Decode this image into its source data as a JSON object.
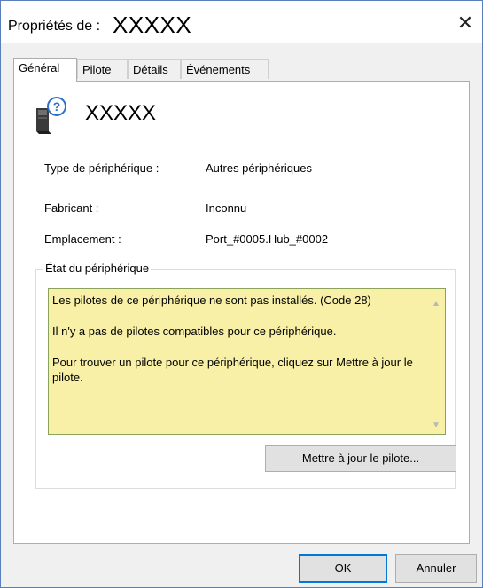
{
  "window": {
    "title_prefix": "Propriétés de :",
    "title_name": "XXXXX",
    "close_glyph": "✕"
  },
  "tabs": [
    {
      "label": "Général",
      "active": true
    },
    {
      "label": "Pilote",
      "active": false
    },
    {
      "label": "Détails",
      "active": false
    },
    {
      "label": "Événements",
      "active": false
    }
  ],
  "device": {
    "icon": "unknown-device-icon",
    "name": "XXXXX"
  },
  "properties": [
    {
      "label": "Type de périphérique :",
      "value": "Autres périphériques"
    },
    {
      "label": "Fabricant :",
      "value": "Inconnu"
    },
    {
      "label": "Emplacement :",
      "value": "Port_#0005.Hub_#0002"
    }
  ],
  "status_group": {
    "legend": "État du périphérique",
    "lines": [
      "Les pilotes de ce périphérique ne sont pas installés. (Code 28)",
      "Il n'y a pas de pilotes compatibles pour ce périphérique.",
      "Pour trouver un pilote pour ce périphérique, cliquez sur Mettre à jour le pilote."
    ],
    "update_button": "Mettre à jour le pilote..."
  },
  "footer": {
    "ok": "OK",
    "cancel": "Annuler"
  },
  "colors": {
    "status_background": "#f8f0a6",
    "default_button_border": "#0078d7"
  }
}
